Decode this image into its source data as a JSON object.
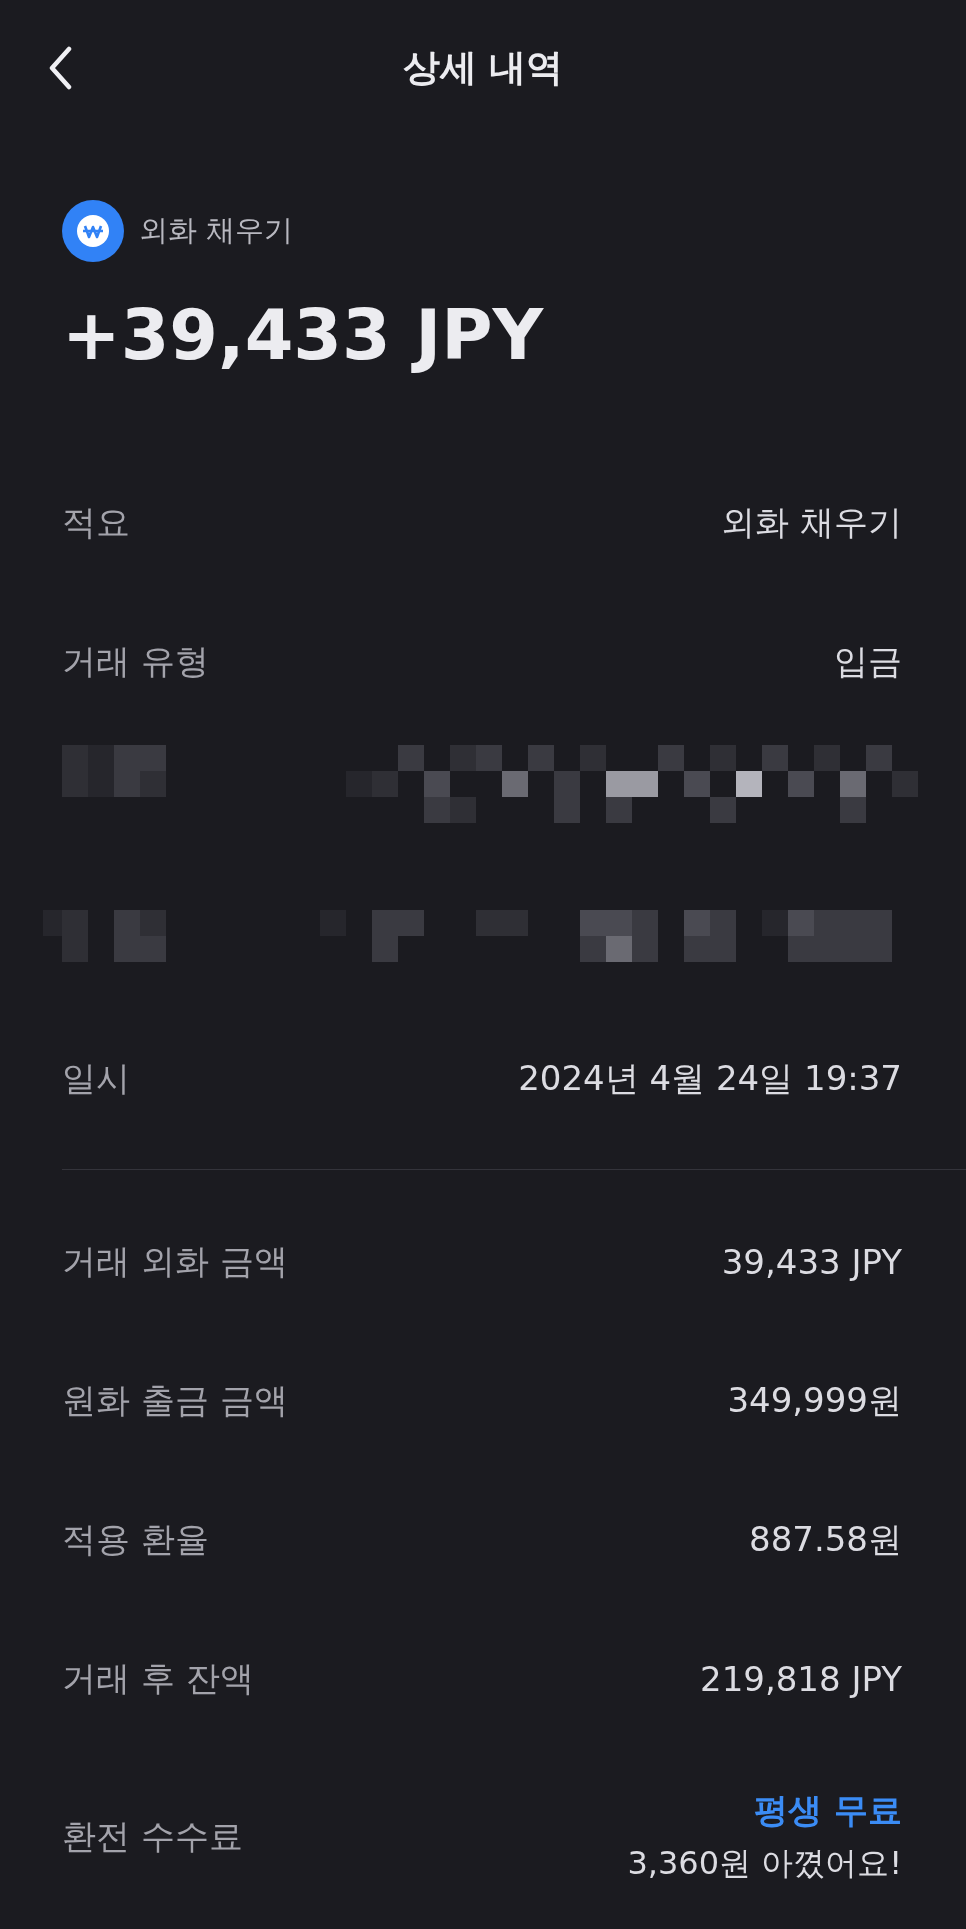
{
  "header": {
    "title": "상세 내역"
  },
  "hero": {
    "label": "외화 채우기",
    "amount": "+39,433 JPY"
  },
  "rows": [
    {
      "kind": "text",
      "label": "적요",
      "value": "외화 채우기"
    },
    {
      "kind": "text",
      "label": "거래 유형",
      "value": "입금"
    },
    {
      "kind": "redacted"
    },
    {
      "kind": "redacted"
    },
    {
      "kind": "text",
      "label": "일시",
      "value": "2024년 4월 24일 19:37"
    },
    {
      "kind": "divider"
    },
    {
      "kind": "text",
      "label": "거래 외화 금액",
      "value": "39,433 JPY"
    },
    {
      "kind": "text",
      "label": "원화 출금 금액",
      "value": "349,999원"
    },
    {
      "kind": "text",
      "label": "적용 환율",
      "value": "887.58원"
    },
    {
      "kind": "text",
      "label": "거래 후 잔액",
      "value": "219,818 JPY"
    },
    {
      "kind": "fee",
      "label": "환전 수수료",
      "highlight": "평생 무료",
      "note": "3,360원 아꼈어요!"
    }
  ]
}
